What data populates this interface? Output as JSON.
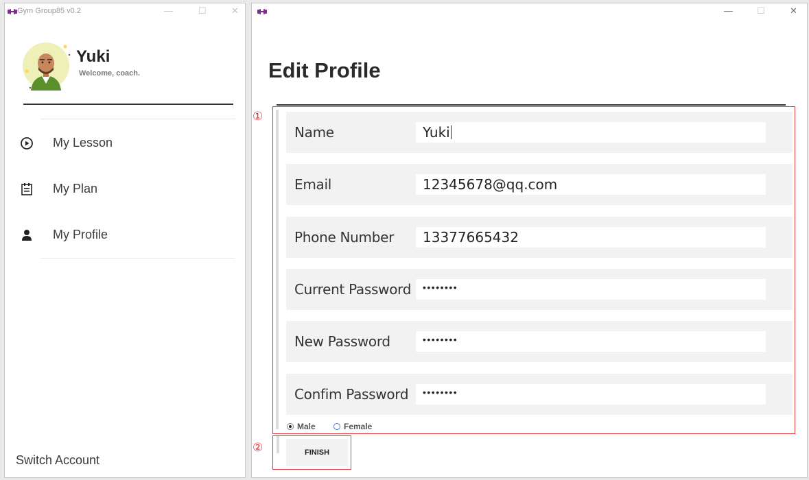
{
  "left_window": {
    "title": "Gym Group85 v0.2",
    "controls": {
      "minimize": "—",
      "maximize": "☐",
      "close": "✕"
    },
    "user": {
      "name": "Yuki",
      "welcome": "Welcome, coach."
    },
    "nav": [
      {
        "label": "My Lesson",
        "icon": "play-circle-icon"
      },
      {
        "label": "My Plan",
        "icon": "plan-calendar-icon"
      },
      {
        "label": "My Profile",
        "icon": "person-icon"
      }
    ],
    "switch_account": "Switch Account"
  },
  "right_window": {
    "controls": {
      "minimize": "—",
      "maximize": "☐",
      "close": "✕"
    },
    "page_title": "Edit Profile",
    "fields": [
      {
        "label": "Name",
        "value": "Yuki"
      },
      {
        "label": "Email",
        "value": "12345678@qq.com"
      },
      {
        "label": "Phone Number",
        "value": "13377665432"
      },
      {
        "label": "Current Password",
        "value": "••••••••"
      },
      {
        "label": "New Password",
        "value": "••••••••"
      },
      {
        "label": "Confim Password",
        "value": "••••••••"
      }
    ],
    "gender": {
      "options": [
        "Male",
        "Female"
      ],
      "selected": "Male"
    },
    "finish_label": "FINISH"
  },
  "annotations": {
    "marker_1": "①",
    "marker_2": "②"
  },
  "colors": {
    "annotation_red": "#e8373d",
    "logo_purple": "#7b2d8e"
  }
}
